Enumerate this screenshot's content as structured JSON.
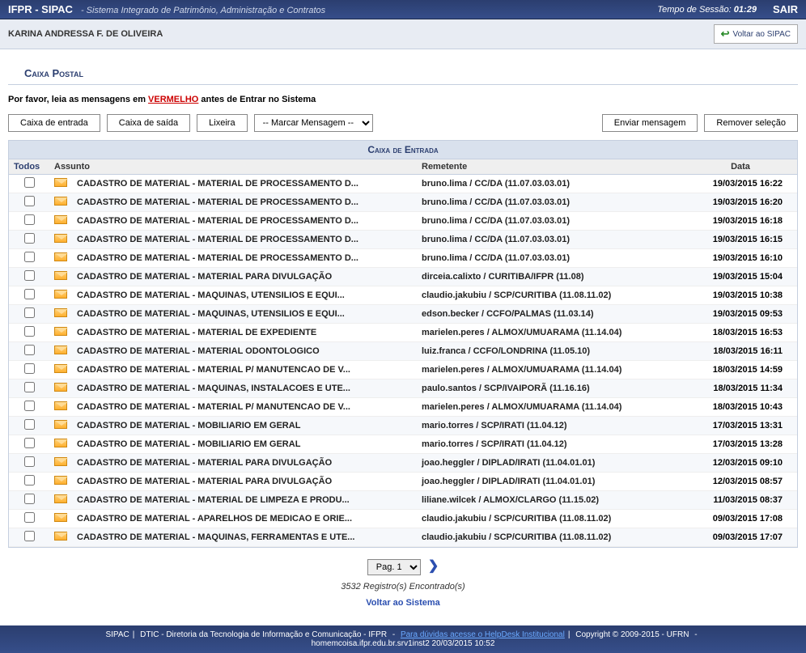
{
  "header": {
    "app": "IFPR - SIPAC",
    "subtitle": "- Sistema Integrado de Patrimônio, Administração e Contratos",
    "session_label": "Tempo de Sessão:",
    "session_time": "01:29",
    "logout": "SAIR"
  },
  "user": {
    "name": "KARINA ANDRESSA F. DE OLIVEIRA",
    "voltar": "Voltar ao SIPAC"
  },
  "page": {
    "title": "Caixa Postal",
    "instruction_prefix": "Por favor, leia as mensagens em ",
    "instruction_red": "VERMELHO",
    "instruction_suffix": " antes de Entrar no Sistema"
  },
  "tabs": {
    "inbox": "Caixa de entrada",
    "outbox": "Caixa de saída",
    "trash": "Lixeira",
    "mark_placeholder": "-- Marcar Mensagem --",
    "send": "Enviar mensagem",
    "remove": "Remover seleção"
  },
  "table": {
    "title": "Caixa de Entrada",
    "col_todos": "Todos",
    "col_assunto": "Assunto",
    "col_remetente": "Remetente",
    "col_data": "Data"
  },
  "rows": [
    {
      "subject": "CADASTRO DE MATERIAL - MATERIAL DE PROCESSAMENTO D...",
      "sender": "bruno.lima / CC/DA (11.07.03.03.01)",
      "date": "19/03/2015 16:22"
    },
    {
      "subject": "CADASTRO DE MATERIAL - MATERIAL DE PROCESSAMENTO D...",
      "sender": "bruno.lima / CC/DA (11.07.03.03.01)",
      "date": "19/03/2015 16:20"
    },
    {
      "subject": "CADASTRO DE MATERIAL - MATERIAL DE PROCESSAMENTO D...",
      "sender": "bruno.lima / CC/DA (11.07.03.03.01)",
      "date": "19/03/2015 16:18"
    },
    {
      "subject": "CADASTRO DE MATERIAL - MATERIAL DE PROCESSAMENTO D...",
      "sender": "bruno.lima / CC/DA (11.07.03.03.01)",
      "date": "19/03/2015 16:15"
    },
    {
      "subject": "CADASTRO DE MATERIAL - MATERIAL DE PROCESSAMENTO D...",
      "sender": "bruno.lima / CC/DA (11.07.03.03.01)",
      "date": "19/03/2015 16:10"
    },
    {
      "subject": "CADASTRO DE MATERIAL - MATERIAL PARA DIVULGAÇÃO",
      "sender": "dirceia.calixto / CURITIBA/IFPR (11.08)",
      "date": "19/03/2015 15:04"
    },
    {
      "subject": "CADASTRO DE MATERIAL - MAQUINAS, UTENSILIOS E EQUI...",
      "sender": "claudio.jakubiu / SCP/CURITIBA (11.08.11.02)",
      "date": "19/03/2015 10:38"
    },
    {
      "subject": "CADASTRO DE MATERIAL - MAQUINAS, UTENSILIOS E EQUI...",
      "sender": "edson.becker / CCFO/PALMAS (11.03.14)",
      "date": "19/03/2015 09:53"
    },
    {
      "subject": "CADASTRO DE MATERIAL - MATERIAL DE EXPEDIENTE",
      "sender": "marielen.peres / ALMOX/UMUARAMA (11.14.04)",
      "date": "18/03/2015 16:53"
    },
    {
      "subject": "CADASTRO DE MATERIAL - MATERIAL ODONTOLOGICO",
      "sender": "luiz.franca / CCFO/LONDRINA (11.05.10)",
      "date": "18/03/2015 16:11"
    },
    {
      "subject": "CADASTRO DE MATERIAL - MATERIAL P/ MANUTENCAO DE V...",
      "sender": "marielen.peres / ALMOX/UMUARAMA (11.14.04)",
      "date": "18/03/2015 14:59"
    },
    {
      "subject": "CADASTRO DE MATERIAL - MAQUINAS, INSTALACOES E UTE...",
      "sender": "paulo.santos / SCP/IVAIPORÃ (11.16.16)",
      "date": "18/03/2015 11:34"
    },
    {
      "subject": "CADASTRO DE MATERIAL - MATERIAL P/ MANUTENCAO DE V...",
      "sender": "marielen.peres / ALMOX/UMUARAMA (11.14.04)",
      "date": "18/03/2015 10:43"
    },
    {
      "subject": "CADASTRO DE MATERIAL - MOBILIARIO EM GERAL",
      "sender": "mario.torres / SCP/IRATI (11.04.12)",
      "date": "17/03/2015 13:31"
    },
    {
      "subject": "CADASTRO DE MATERIAL - MOBILIARIO EM GERAL",
      "sender": "mario.torres / SCP/IRATI (11.04.12)",
      "date": "17/03/2015 13:28"
    },
    {
      "subject": "CADASTRO DE MATERIAL - MATERIAL PARA DIVULGAÇÃO",
      "sender": "joao.heggler / DIPLAD/IRATI (11.04.01.01)",
      "date": "12/03/2015 09:10"
    },
    {
      "subject": "CADASTRO DE MATERIAL - MATERIAL PARA DIVULGAÇÃO",
      "sender": "joao.heggler / DIPLAD/IRATI (11.04.01.01)",
      "date": "12/03/2015 08:57"
    },
    {
      "subject": "CADASTRO DE MATERIAL - MATERIAL DE LIMPEZA E PRODU...",
      "sender": "liliane.wilcek / ALMOX/CLARGO (11.15.02)",
      "date": "11/03/2015 08:37"
    },
    {
      "subject": "CADASTRO DE MATERIAL - APARELHOS DE MEDICAO E ORIE...",
      "sender": "claudio.jakubiu / SCP/CURITIBA (11.08.11.02)",
      "date": "09/03/2015 17:08"
    },
    {
      "subject": "CADASTRO DE MATERIAL - MAQUINAS, FERRAMENTAS E UTE...",
      "sender": "claudio.jakubiu / SCP/CURITIBA (11.08.11.02)",
      "date": "09/03/2015 17:07"
    }
  ],
  "pager": {
    "page_label": "Pag. 1",
    "records": "3532 Registro(s) Encontrado(s)",
    "back_system": "Voltar ao Sistema"
  },
  "footer": {
    "left": "SIPAC",
    "dtic": "DTIC - Diretoria da Tecnologia de Informação e Comunicação - IFPR",
    "help": "Para dúvidas acesse o HelpDesk Institucional",
    "copyright": "Copyright © 2009-2015 - UFRN",
    "host": "homemcoisa.ifpr.edu.br.srv1inst2",
    "timestamp": "20/03/2015 10:52"
  }
}
